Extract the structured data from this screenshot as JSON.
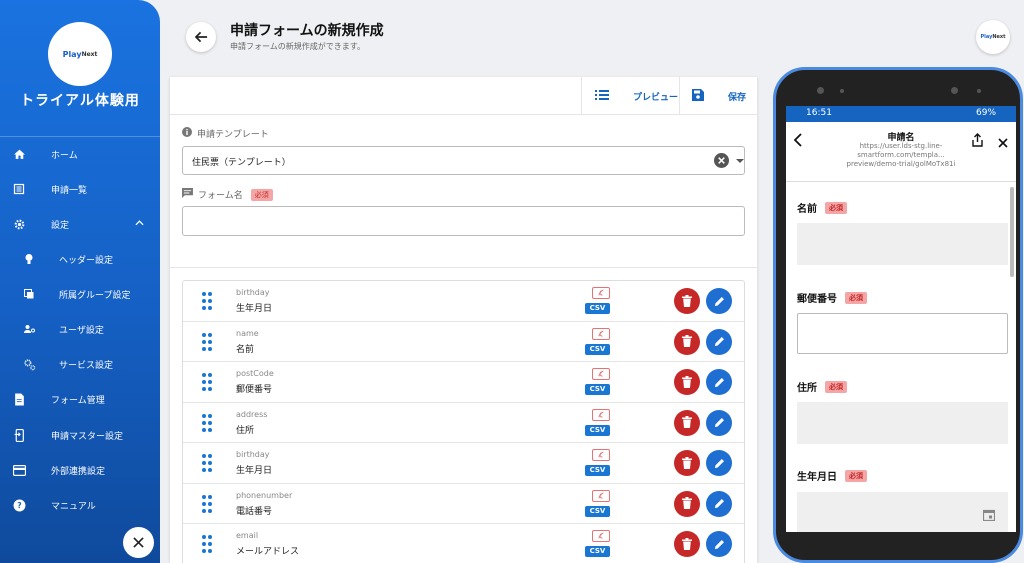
{
  "sidebar": {
    "logo_brand": "Play",
    "logo_suffix": "Next",
    "title": "トライアル体験用",
    "items": [
      {
        "label": "ホーム",
        "icon": "home-icon"
      },
      {
        "label": "申請一覧",
        "icon": "list-icon"
      },
      {
        "label": "設定",
        "icon": "gear-icon"
      },
      {
        "label": "ヘッダー設定",
        "icon": "header-settings-icon"
      },
      {
        "label": "所属グループ設定",
        "icon": "group-icon"
      },
      {
        "label": "ユーザ設定",
        "icon": "user-settings-icon"
      },
      {
        "label": "サービス設定",
        "icon": "service-gear-icon"
      },
      {
        "label": "フォーム管理",
        "icon": "form-icon"
      },
      {
        "label": "申請マスター設定",
        "icon": "master-icon"
      },
      {
        "label": "外部連携設定",
        "icon": "card-icon"
      },
      {
        "label": "マニュアル",
        "icon": "help-icon"
      }
    ]
  },
  "header": {
    "title": "申請フォームの新規作成",
    "subtitle": "申請フォームの新規作成ができます。"
  },
  "toolbar": {
    "preview_label": "プレビュー",
    "save_label": "保存"
  },
  "form": {
    "template_label": "申請テンプレート",
    "template_value": "住民票（テンプレート）",
    "name_label": "フォーム名",
    "required_badge": "必須",
    "name_value": ""
  },
  "fields": [
    {
      "key": "birthday",
      "label": "生年月日",
      "csv": "CSV"
    },
    {
      "key": "name",
      "label": "名前",
      "csv": "CSV"
    },
    {
      "key": "postCode",
      "label": "郵便番号",
      "csv": "CSV"
    },
    {
      "key": "address",
      "label": "住所",
      "csv": "CSV"
    },
    {
      "key": "birthday",
      "label": "生年月日",
      "csv": "CSV"
    },
    {
      "key": "phonenumber",
      "label": "電話番号",
      "csv": "CSV"
    },
    {
      "key": "email",
      "label": "メールアドレス",
      "csv": "CSV"
    }
  ],
  "phone": {
    "time": "16:51",
    "battery": "69%",
    "title": "申請名",
    "url": "https://user.lds-stg.line-smartform.com/templa... preview/demo-trial/golMoTx81i",
    "fields": [
      {
        "label": "名前",
        "required": "必須"
      },
      {
        "label": "郵便番号",
        "required": "必須"
      },
      {
        "label": "住所",
        "required": "必須"
      },
      {
        "label": "生年月日",
        "required": "必須"
      }
    ]
  },
  "colors": {
    "accent": "#1976d2",
    "danger": "#c62828",
    "required_bg": "#f4a6a6"
  }
}
